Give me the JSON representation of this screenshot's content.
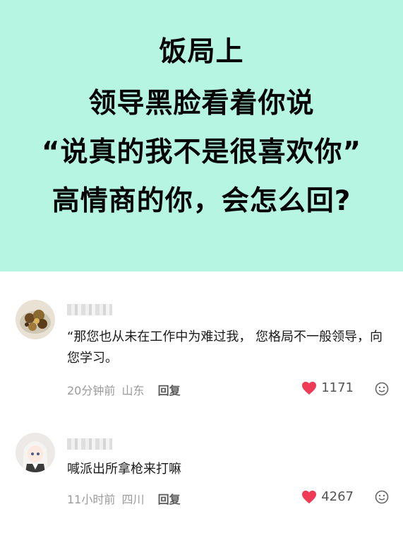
{
  "banner": {
    "line1": "饭局上",
    "line2": "领导黑脸看着你说",
    "line3": "“说真的我不是很喜欢你”",
    "line4": "高情商的你，会怎么回?",
    "background": "#b6f5e2"
  },
  "comments": [
    {
      "text": "“那您也从未在工作中为难过我，  您格局不一般领导，向您学习。",
      "time": "20分钟前",
      "location": "山东",
      "reply_label": "回复",
      "likes": "1171",
      "like_icon": "heart-icon",
      "emoji_icon": "emoji-icon"
    },
    {
      "text": "喊派出所拿枪来打嘛",
      "time": "11小时前",
      "location": "四川",
      "reply_label": "回复",
      "likes": "4267",
      "like_icon": "heart-icon",
      "emoji_icon": "emoji-icon"
    }
  ],
  "colors": {
    "heart": "#ef3b55",
    "meta": "#9a9a9a"
  }
}
